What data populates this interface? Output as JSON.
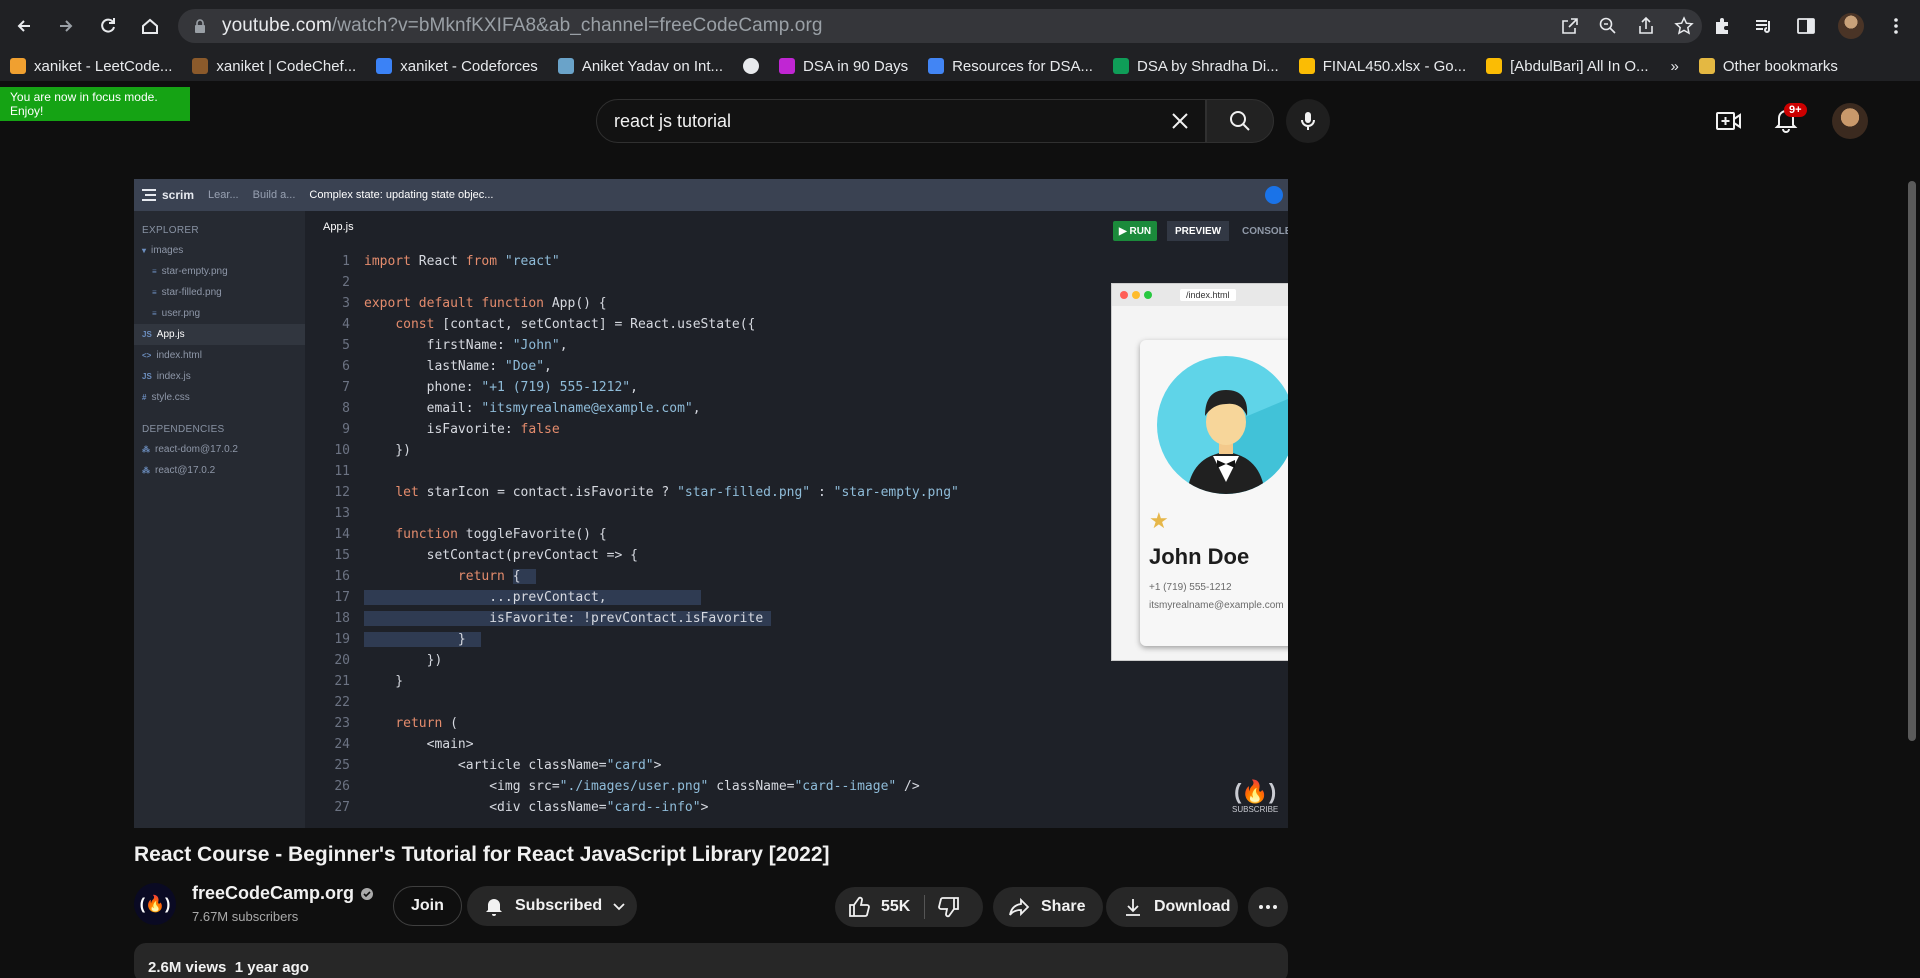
{
  "browser": {
    "url_host": "youtube.com",
    "url_path": "/watch?v=bMknfKXIFA8&ab_channel=freeCodeCamp.org",
    "bookmarks": [
      {
        "label": "xaniket - LeetCode...",
        "color": "#f0a030"
      },
      {
        "label": "xaniket | CodeChef...",
        "color": "#8b5a2b"
      },
      {
        "label": "xaniket - Codeforces",
        "color": "#3b82f6"
      },
      {
        "label": "Aniket Yadav on Int...",
        "color": "#6aa3c9"
      },
      {
        "label": "",
        "color": "#e8eaed"
      },
      {
        "label": "DSA in 90 Days",
        "color": "#c026d3"
      },
      {
        "label": "Resources for DSA...",
        "color": "#4285f4"
      },
      {
        "label": "DSA by Shradha Di...",
        "color": "#0f9d58"
      },
      {
        "label": "FINAL450.xlsx - Go...",
        "color": "#fbbc04"
      },
      {
        "label": "[AbdulBari] All In O...",
        "color": "#fbbc04"
      }
    ],
    "more_label": "»",
    "other_bookmarks": "Other bookmarks"
  },
  "youtube": {
    "focus_toast": "You are now in focus mode. Enjoy!",
    "search_query": "react js tutorial",
    "notif_count": "9+"
  },
  "video": {
    "scrim": {
      "logo": "scrim",
      "crumb1": "Lear...",
      "crumb2": "Build a...",
      "title": "Complex state: updating state objec..."
    },
    "explorer": {
      "header": "EXPLORER",
      "folder": "images",
      "files_in_images": [
        "star-empty.png",
        "star-filled.png",
        "user.png"
      ],
      "root_files": [
        {
          "tag": "JS",
          "name": "App.js",
          "active": true
        },
        {
          "tag": "<>",
          "name": "index.html",
          "active": false
        },
        {
          "tag": "JS",
          "name": "index.js",
          "active": false
        },
        {
          "tag": "#",
          "name": "style.css",
          "active": false
        }
      ],
      "deps_header": "DEPENDENCIES",
      "deps": [
        "react-dom@17.0.2",
        "react@17.0.2"
      ]
    },
    "editor": {
      "tab": "App.js",
      "run": "RUN",
      "preview": "PREVIEW",
      "console": "CONSOLE"
    },
    "preview": {
      "url": "/index.html",
      "name": "John Doe",
      "phone": "+1 (719) 555-1212",
      "email": "itsmyrealname@example.com"
    },
    "watermark": "SUBSCRIBE"
  },
  "meta": {
    "title": "React Course - Beginner's Tutorial for React JavaScript Library [2022]",
    "channel": "freeCodeCamp.org",
    "subscribers": "7.67M subscribers",
    "join": "Join",
    "subscribed": "Subscribed",
    "likes": "55K",
    "share": "Share",
    "download": "Download",
    "views": "2.6M views",
    "ago": "1 year ago"
  }
}
